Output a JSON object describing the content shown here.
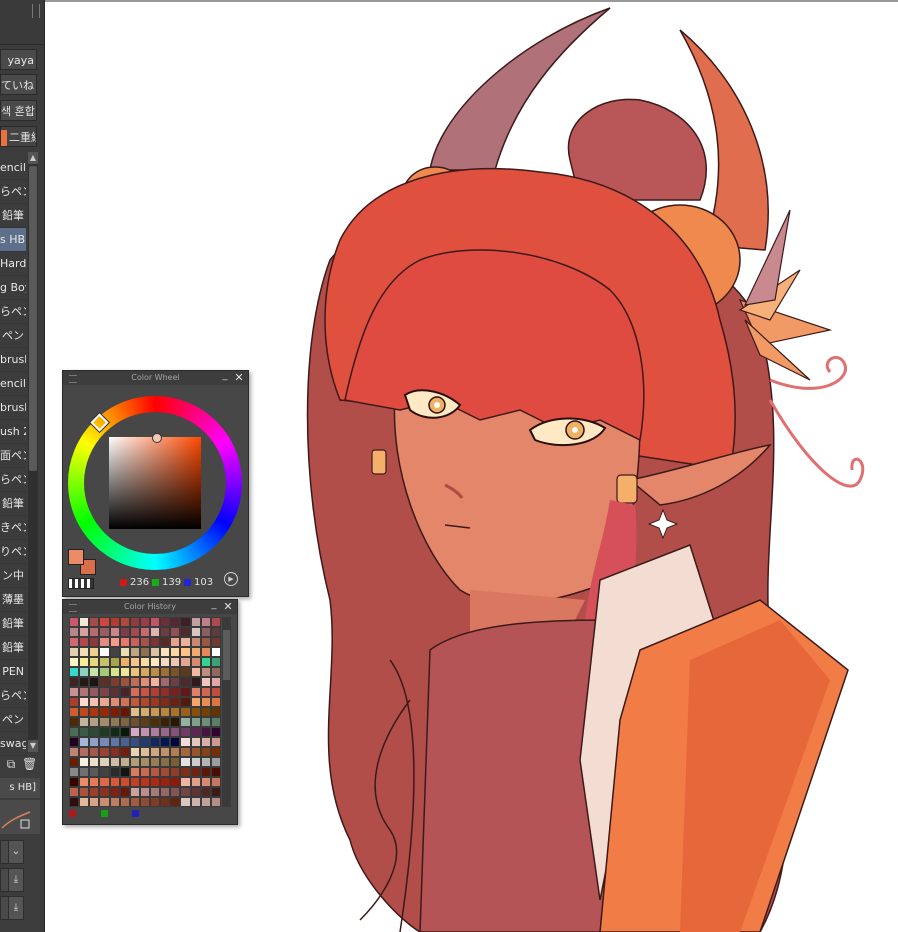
{
  "sidebar": {
    "top_buttons": [
      "yaya",
      "ていね",
      "색 혼합",
      "二重線"
    ],
    "brushes": [
      {
        "label": "encil"
      },
      {
        "label": "らペン"
      },
      {
        "label": "鉛筆"
      },
      {
        "label": "s HB",
        "selected": true
      },
      {
        "label": "Hard"
      },
      {
        "label": "g Boy"
      },
      {
        "label": "らペン"
      },
      {
        "label": "ペン"
      },
      {
        "label": "brush"
      },
      {
        "label": "encil"
      },
      {
        "label": "brush"
      },
      {
        "label": "ush 2"
      },
      {
        "label": "面ペン"
      },
      {
        "label": "らペン"
      },
      {
        "label": "鉛筆"
      },
      {
        "label": "きペン"
      },
      {
        "label": "りペン"
      },
      {
        "label": "ン中"
      },
      {
        "label": "薄墨"
      },
      {
        "label": "鉛筆"
      },
      {
        "label": "鉛筆"
      },
      {
        "label": "PEN"
      },
      {
        "label": "らペン"
      },
      {
        "label": "ペン"
      },
      {
        "label": "swag"
      }
    ],
    "current_brush": "s HB]"
  },
  "color_wheel": {
    "title": "Color Wheel",
    "main_color": "#EC8B67",
    "r": "236",
    "g": "139",
    "b": "103"
  },
  "color_history": {
    "title": "Color History",
    "swatches": [
      "#c9586a",
      "#f3ead7",
      "#a44c4c",
      "#d0453e",
      "#b53b31",
      "#ad4a3d",
      "#8d3d3d",
      "#9b3c4a",
      "#c25564",
      "#6e2e36",
      "#582737",
      "#3f1e24",
      "#c2a0a1",
      "#c07e8a",
      "#ac4a4f",
      "#b6868c",
      "#d6a2a1",
      "#b66b6d",
      "#9a5c62",
      "#c9868b",
      "#7c3e48",
      "#a04a54",
      "#c46a70",
      "#e1b3b0",
      "#6b3d40",
      "#944e55",
      "#4d2a2e",
      "#d8c5c0",
      "#8b5f62",
      "#5d3b3f",
      "#d16a6e",
      "#b14a4f",
      "#8a3a3e",
      "#e38c82",
      "#f29c8e",
      "#e87a6d",
      "#cb5f59",
      "#a8524f",
      "#7b3333",
      "#5b2727",
      "#e4a18c",
      "#ecb39c",
      "#c88771",
      "#995745",
      "#6f3b31",
      "#e3cfae",
      "#f2dfb8",
      "#edd08f",
      "#ffffff",
      "#444444",
      "#eaddb4",
      "#bfa584",
      "#8f7158",
      "#dcc3a3",
      "#f7e3c0",
      "#ffd7a0",
      "#ffc388",
      "#f1a96e",
      "#e7885a",
      "#ffffff",
      "#fbf5c8",
      "#f9ec96",
      "#e9d87b",
      "#c7c06b",
      "#a6a54f",
      "#edb06a",
      "#f4c48b",
      "#f8dca2",
      "#ffe8bd",
      "#f4d9c4",
      "#efc6b0",
      "#e3a78f",
      "#d68a72",
      "#35d48c",
      "#3aa276",
      "#36d9c7",
      "#8ad3c2",
      "#c8e3a7",
      "#a6c776",
      "#d7e48c",
      "#efe79c",
      "#e9c57a",
      "#d8a85e",
      "#bf8d4a",
      "#9e7036",
      "#7a5427",
      "#5a3c1c",
      "#f2b9a4",
      "#bd8e7d",
      "#8f6a5e",
      "#3a2523",
      "#241918",
      "#1d1313",
      "#5b3027",
      "#7a3d30",
      "#9e5240",
      "#c06c57",
      "#e28d77",
      "#f5b29c",
      "#a2686c",
      "#6c3f44",
      "#4b2b30",
      "#2f1a1e",
      "#f3c4c0",
      "#e1a8a7",
      "#c98f91",
      "#b07477",
      "#925a5f",
      "#7a444a",
      "#5e3036",
      "#46232a",
      "#d96b5a",
      "#c75447",
      "#b13f36",
      "#952c27",
      "#7b201f",
      "#641719",
      "#e07f6a",
      "#d16753",
      "#c04e3c",
      "#ac3c2c",
      "#fcd9cc",
      "#f2c1b0",
      "#e8a791",
      "#dd8d73",
      "#d07356",
      "#c2593a",
      "#b2452a",
      "#9e3620",
      "#852a18",
      "#6c2112",
      "#54190d",
      "#f6a56b",
      "#e98d55",
      "#dc7541",
      "#cf5e2f",
      "#c0481f",
      "#ad3612",
      "#982808",
      "#801c02",
      "#6b1500",
      "#e0c08a",
      "#d4ac70",
      "#c79856",
      "#b9853f",
      "#aa722b",
      "#996019",
      "#87500b",
      "#744101",
      "#613400",
      "#4f2900",
      "#c4b49e",
      "#b3a085",
      "#a28c6d",
      "#917856",
      "#806440",
      "#6e512c",
      "#5c3f19",
      "#4a2f09",
      "#3a2200",
      "#2a1700",
      "#94b0a0",
      "#80a08d",
      "#6d8f7a",
      "#5b7e68",
      "#4a6d57",
      "#3a5c46",
      "#2b4b36",
      "#1e3a27",
      "#122a19",
      "#08190c",
      "#d5a9c2",
      "#c293b0",
      "#ae7d9e",
      "#9a678b",
      "#855178",
      "#703c65",
      "#5b2752",
      "#461440",
      "#31032e",
      "#21001f",
      "#a6b7d7",
      "#8ea1c6",
      "#778bb5",
      "#6076a4",
      "#4a6193",
      "#354d82",
      "#223971",
      "#112760",
      "#03164f",
      "#00073e",
      "#f4dcd8",
      "#e8c6c0",
      "#dbafa7",
      "#ce998f",
      "#c18377",
      "#b36d60",
      "#a5584a",
      "#964334",
      "#872f20",
      "#771c0c",
      "#e9d3b5",
      "#dcbd9b",
      "#cfa882",
      "#c1926a",
      "#b37d53",
      "#a5683d",
      "#965428",
      "#874115",
      "#772e04",
      "#662000",
      "#f7efe3",
      "#eadfcd",
      "#ddcfb8",
      "#cfbea3",
      "#c1ae8e",
      "#b39e7b",
      "#a48e68",
      "#967e56",
      "#876e45",
      "#785f35",
      "#e3e3e3",
      "#cccccc",
      "#b5b5b5",
      "#9e9e9e",
      "#878787",
      "#707070",
      "#595959",
      "#424242",
      "#2b2b2b",
      "#141414",
      "#d97b5e",
      "#c76a4f",
      "#b55a41",
      "#a34a34",
      "#913b28",
      "#7f2e1d",
      "#6d2213",
      "#5b170a",
      "#490d03",
      "#370500",
      "#ec8b67",
      "#e67a56",
      "#df6a47",
      "#d75b3a",
      "#ce4d2e",
      "#c44024",
      "#b9341b",
      "#ad2913",
      "#a0200d",
      "#921708",
      "#f0b3a0",
      "#e39e8a",
      "#d68a75",
      "#c87661",
      "#ba634e",
      "#ab513d",
      "#9c402d",
      "#8c301f",
      "#7c2312",
      "#6b1707",
      "#caa3a0",
      "#b88f8c",
      "#a57b79",
      "#936866",
      "#815654",
      "#704543",
      "#5e3533",
      "#4d2625",
      "#3d1918",
      "#2e0e0d",
      "#e5b79b",
      "#d8a387",
      "#cb9074",
      "#bd7e62",
      "#af6c51",
      "#a05b41",
      "#914b33",
      "#823c26",
      "#722f1a",
      "#62230f",
      "#dcc7c0",
      "#cfb4ac",
      "#c2a199",
      "#b48f86",
      "#a67d74",
      "#986c63",
      "#895b53",
      "#7a4b44",
      "#6a3c36",
      "#5a2e29",
      "#f1a294",
      "#e68d80",
      "#da786c",
      "#cd655a",
      "#bf5249",
      "#b1413a",
      "#a2312c",
      "#92231f",
      "#821614",
      "#710b0a"
    ]
  }
}
